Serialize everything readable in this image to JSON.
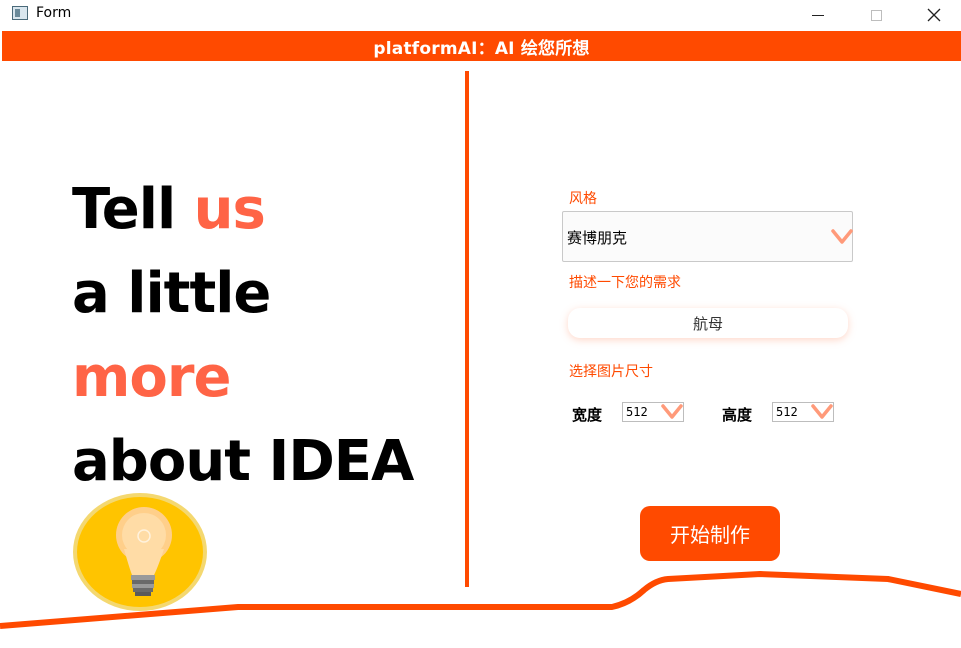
{
  "window": {
    "title": "Form",
    "icons": [
      "app-window-icon",
      "minimize-icon",
      "maximize-icon",
      "close-icon"
    ]
  },
  "header": {
    "title": "platformAI：AI 绘您所想"
  },
  "hero": {
    "line1_a": "Tell ",
    "line1_b": "us",
    "line2": "a little",
    "line3": "more",
    "line4": "about IDEA"
  },
  "form": {
    "style_label": "风格",
    "style_value": "赛博朋克",
    "desc_label": "描述一下您的需求",
    "desc_value": "航母",
    "size_label": "选择图片尺寸",
    "width_label": "宽度",
    "width_value": "512",
    "height_label": "高度",
    "height_value": "512",
    "start_button": "开始制作"
  },
  "colors": {
    "accent": "#ff4a00",
    "accent_light": "#ff6446",
    "bulb": "#ffc400"
  }
}
